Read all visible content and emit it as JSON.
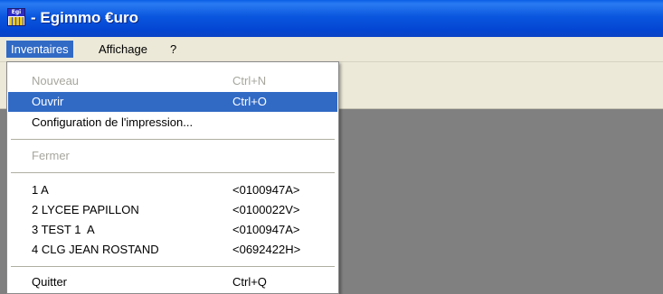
{
  "window": {
    "title": "- Egimmo €uro",
    "icon": "egimmo-app-icon",
    "icon_text": "Egi"
  },
  "menubar": {
    "items": [
      {
        "label": "Inventaires",
        "active": true
      },
      {
        "label": "Affichage",
        "active": false
      },
      {
        "label": "?",
        "active": false
      }
    ]
  },
  "dropdown": {
    "entries": [
      {
        "label": "Nouveau",
        "accel": "Ctrl+N",
        "disabled": true,
        "selected": false
      },
      {
        "label": "Ouvrir",
        "accel": "Ctrl+O",
        "disabled": false,
        "selected": true
      },
      {
        "label": "Configuration de l'impression...",
        "accel": "",
        "disabled": false,
        "selected": false
      },
      {
        "label": "Fermer",
        "accel": "",
        "disabled": true,
        "selected": false
      },
      {
        "label": "1 A",
        "accel": "<0100947A>",
        "disabled": false,
        "selected": false
      },
      {
        "label": "2 LYCEE PAPILLON",
        "accel": "<0100022V>",
        "disabled": false,
        "selected": false
      },
      {
        "label": "3 TEST 1  A",
        "accel": "<0100947A>",
        "disabled": false,
        "selected": false
      },
      {
        "label": "4 CLG JEAN ROSTAND",
        "accel": "<0692422H>",
        "disabled": false,
        "selected": false
      },
      {
        "label": "Quitter",
        "accel": "Ctrl+Q",
        "disabled": false,
        "selected": false
      }
    ]
  },
  "colors": {
    "titlebar": "#0a56de",
    "menu_highlight": "#316ac5",
    "mdi_background": "#808080",
    "chrome": "#ece9d8",
    "disabled_text": "#a7a69e"
  }
}
